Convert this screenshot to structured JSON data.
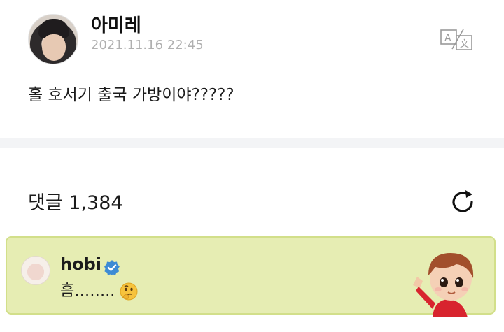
{
  "post": {
    "author": "아미레",
    "timestamp": "2021.11.16 22:45",
    "text": "홀 호서기 출국 가방이야?????",
    "translate_icon": "translate-icon"
  },
  "comments": {
    "header": "댓글 1,384",
    "refresh_icon": "refresh-icon"
  },
  "pinned_comment": {
    "author": "hobi",
    "verified_icon": "verified-badge-icon",
    "text": "흠……..",
    "emoji": "thinking-face-emoji",
    "sticker": "character-sticker",
    "colors": {
      "background": "#e6edb3",
      "border": "#d2df8a",
      "verified": "#3d8bd4"
    }
  }
}
